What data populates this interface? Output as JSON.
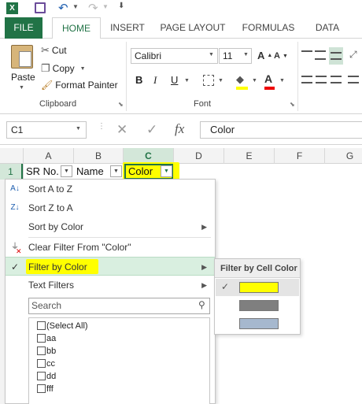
{
  "qat": {
    "app_icon": "excel-icon",
    "save_icon": "save-icon",
    "undo_icon": "undo-icon",
    "redo_icon": "redo-icon",
    "customize_icon": "customize-icon"
  },
  "tabs": {
    "file": "FILE",
    "home": "HOME",
    "insert": "INSERT",
    "page_layout": "PAGE LAYOUT",
    "formulas": "FORMULAS",
    "data": "DATA"
  },
  "clipboard": {
    "paste": "Paste",
    "cut": "Cut",
    "copy": "Copy",
    "format_painter": "Format Painter",
    "group": "Clipboard"
  },
  "font": {
    "name": "Calibri",
    "size": "11",
    "bold": "B",
    "italic": "I",
    "underline": "U",
    "group": "Font"
  },
  "formula_bar": {
    "name_box": "C1",
    "cancel": "✕",
    "enter": "✓",
    "fx": "fx",
    "value": "Color"
  },
  "columns": [
    "A",
    "B",
    "C",
    "D",
    "E",
    "F",
    "G"
  ],
  "rows": [
    "1"
  ],
  "cells": {
    "a1": "SR No.",
    "b1": "Name",
    "c1": "Color"
  },
  "filter_menu": {
    "sort_az": "Sort A to Z",
    "sort_za": "Sort Z to A",
    "sort_by_color": "Sort by Color",
    "clear_filter": "Clear Filter From \"Color\"",
    "filter_by_color": "Filter by Color",
    "text_filters": "Text Filters",
    "search_placeholder": "Search",
    "items": [
      "(Select All)",
      "aa",
      "bb",
      "cc",
      "dd",
      "fff"
    ]
  },
  "submenu": {
    "title": "Filter by Cell Color",
    "colors": [
      "#ffff00",
      "#7f7f7f",
      "#a6b8ce"
    ]
  },
  "colors": {
    "accent": "#217346",
    "highlight": "#ffff00",
    "hover": "#d9efe0"
  }
}
